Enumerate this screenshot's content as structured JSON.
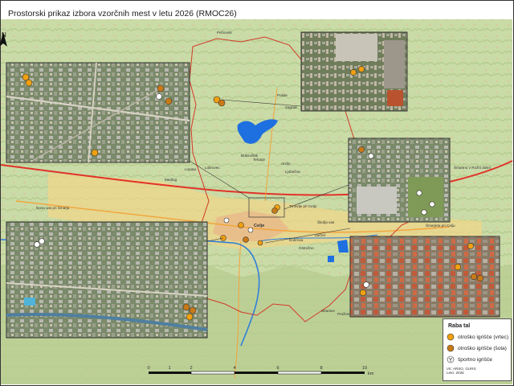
{
  "title": "Prostorski prikaz izbora vzorčnih mest v letu 2026 (RMOC26)",
  "north": {
    "label": "N"
  },
  "legend": {
    "title": "Raba tal",
    "items": [
      {
        "label": "otroško igrišče (vrtec)",
        "icon": "playground-kindergarten-icon",
        "color": "#f0a010"
      },
      {
        "label": "otroško igrišče (šola)",
        "icon": "playground-school-icon",
        "color": "#c87a18"
      },
      {
        "label": "športno igrišče",
        "icon": "sports-field-icon",
        "color": "#ffffff"
      }
    ]
  },
  "scalebar": {
    "ticks": [
      "0",
      "1",
      "2",
      "4",
      "6",
      "8",
      "10"
    ],
    "unit": "km"
  },
  "credits": {
    "line1": "Vir: ARSO, GURS",
    "line2": "Leto: 2026"
  },
  "place_labels": [
    "Pečovnik",
    "Polule",
    "Zagrad",
    "Bukovžlak",
    "Teharje",
    "Lokrovec",
    "Šmartno v Rožni dolini",
    "Arclin",
    "Ljubečna",
    "Trnovlje pri Celju",
    "Škofja vas",
    "Vojnik",
    "Lopata",
    "Medlog",
    "Šmarjeta pri Celju",
    "Dobrova",
    "Ostrožno",
    "Začret",
    "Pristava",
    "Stranice",
    "Celje",
    "Bukovje",
    "Prožinska vas",
    "Nova vas pri Šmarju"
  ],
  "colors": {
    "boundary": "#d23a2a",
    "motorway": "#e0342a",
    "river": "#2f7fd8",
    "lake": "#1e6fe0",
    "urban": "#f2d27a",
    "relief_low": "#cfe0b0",
    "relief_high": "#b9cf94"
  }
}
